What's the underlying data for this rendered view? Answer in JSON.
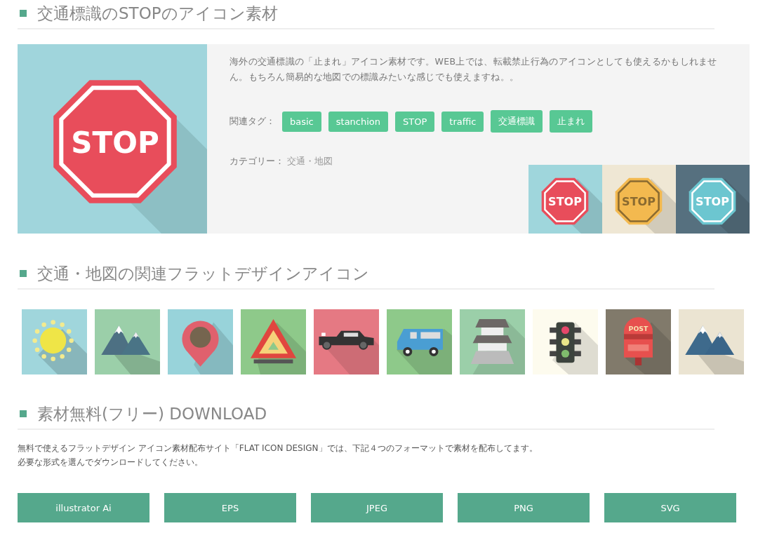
{
  "header": {
    "title": "交通標識のSTOPのアイコン素材"
  },
  "hero": {
    "sign_text": "STOP",
    "description": "海外の交通標識の「止まれ」アイコン素材です。WEB上では、転載禁止行為のアイコンとしても使えるかもしれません。もちろん簡易的な地図での標識みたいな感じでも使えますね。。",
    "tags_label": "関連タグ：",
    "tags": [
      "basic",
      "stanchion",
      "STOP",
      "traffic",
      "交通標識",
      "止まれ"
    ],
    "category_label": "カテゴリー：",
    "category": "交通・地図",
    "variants": [
      {
        "label": "STOP",
        "color": "#9fd6dc",
        "sign": {
          "color": "#e84d5b"
        }
      },
      {
        "label": "STOP",
        "color": "#efe7d4",
        "sign": {
          "color": "#f3b94f"
        }
      },
      {
        "label": "STOP",
        "color": "#56707f",
        "sign": {
          "color": "#6cc6d0"
        }
      }
    ]
  },
  "related": {
    "title": "交通・地図の関連フラットデザインアイコン",
    "icons": [
      {
        "kind": "sun",
        "color": "#a0d6dc"
      },
      {
        "kind": "mountains",
        "color": "#9bcfa9"
      },
      {
        "kind": "pin",
        "color": "#98d3da"
      },
      {
        "kind": "warning-triangle",
        "color": "#8ec98a"
      },
      {
        "kind": "car",
        "color": "#e57983"
      },
      {
        "kind": "van",
        "color": "#8ec98a"
      },
      {
        "kind": "castle",
        "color": "#9bcfa9"
      },
      {
        "kind": "traffic-light",
        "color": "#fdfbee"
      },
      {
        "kind": "mailbox",
        "color": "#817a6b",
        "label": "POST"
      },
      {
        "kind": "mountains-2",
        "color": "#ebe4d2"
      }
    ]
  },
  "download": {
    "title": "素材無料(フリー) DOWNLOAD",
    "lines": [
      "無料で使えるフラットデザイン アイコン素材配布サイト「FLAT ICON DESIGN」では、下記４つのフォーマットで素材を配布してます。",
      "必要な形式を選んでダウンロードしてください。"
    ],
    "buttons": [
      "illustrator Ai",
      "EPS",
      "JPEG",
      "PNG",
      "SVG"
    ]
  }
}
